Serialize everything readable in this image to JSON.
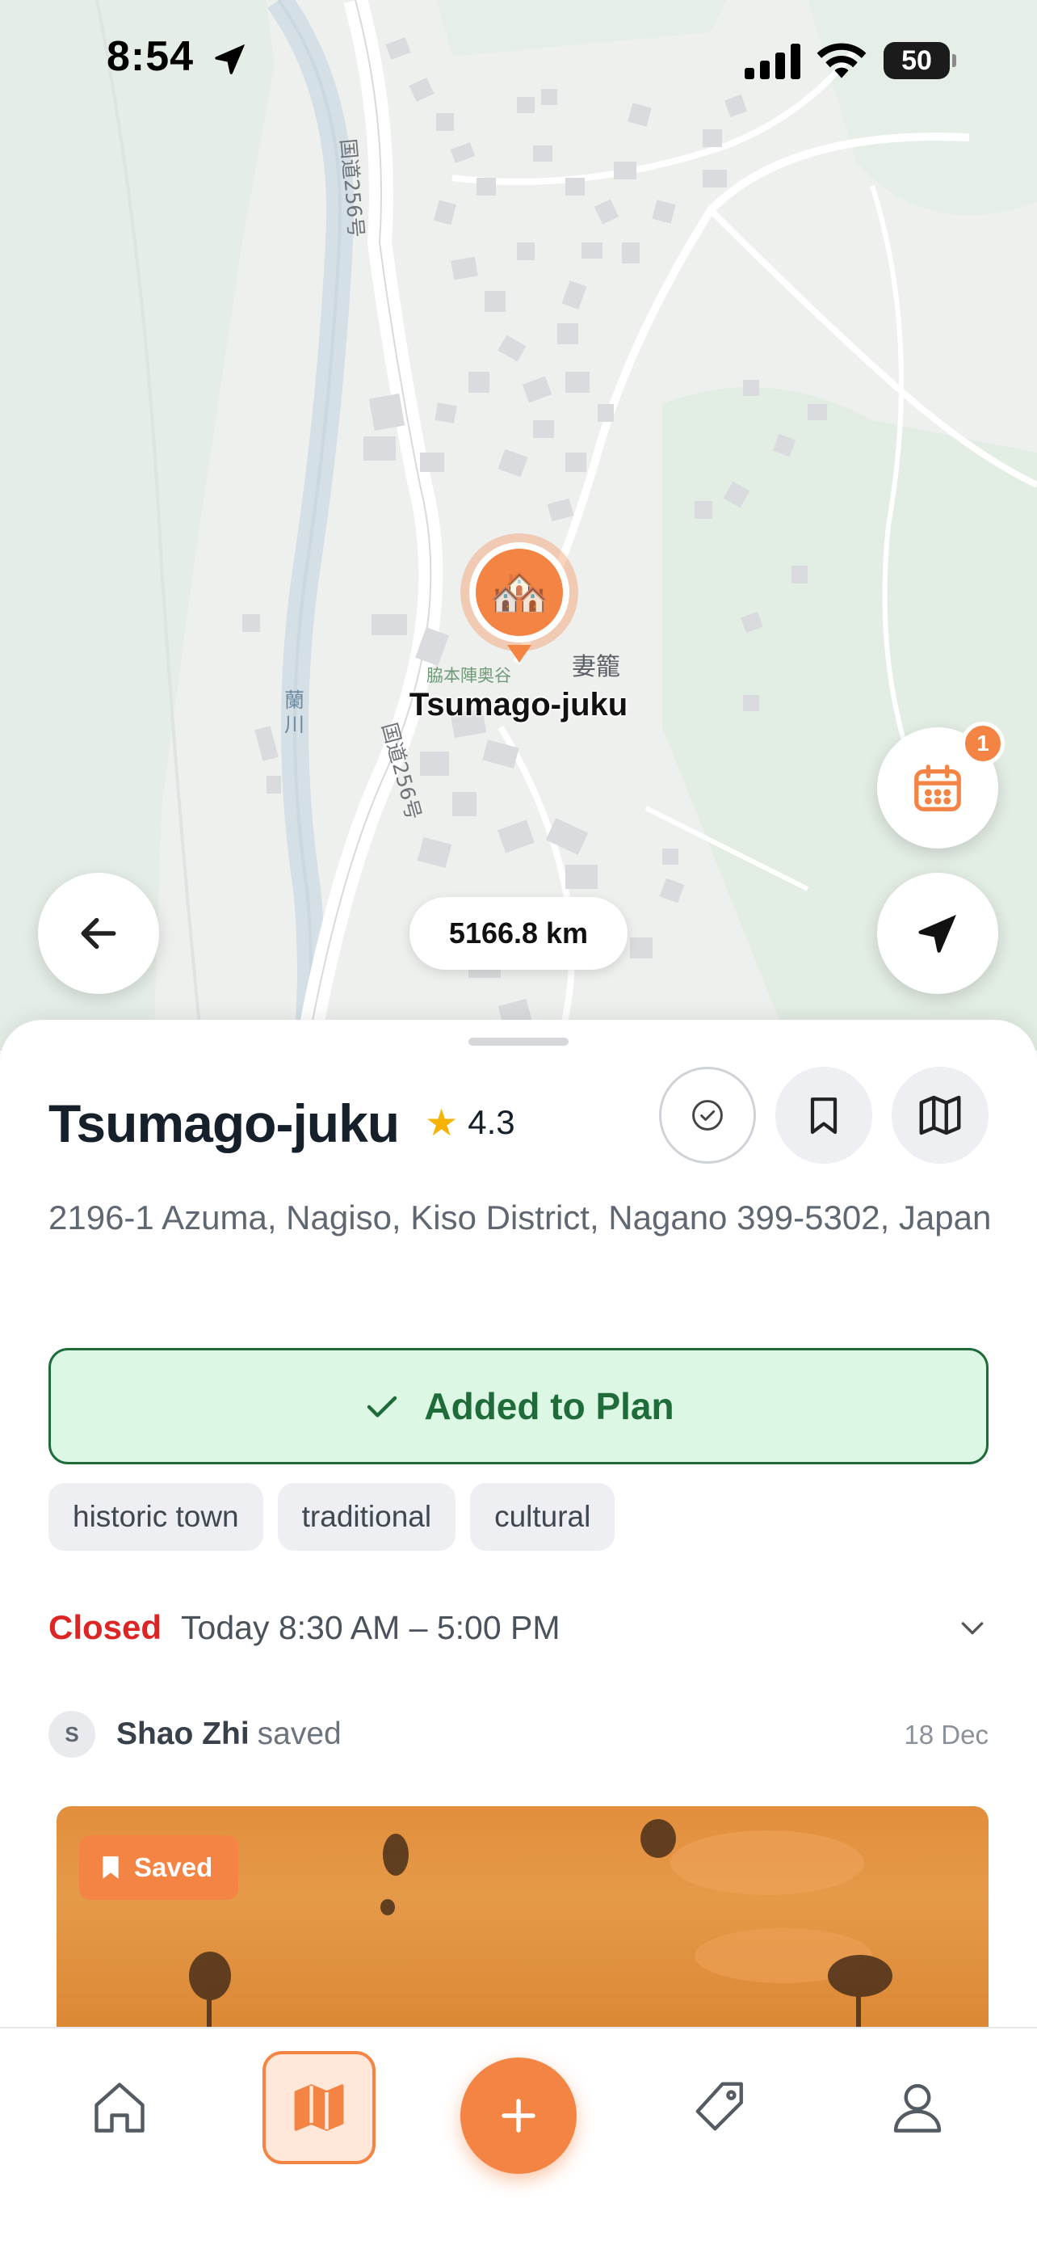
{
  "status_bar": {
    "time": "8:54",
    "battery": "50"
  },
  "map": {
    "road_label_1": "国道256号",
    "road_label_2": "国道256号",
    "river_label": "蘭川",
    "place_label": "妻籠",
    "poi_label": "脇本陣奥谷",
    "pin_label": "Tsumago-juku",
    "pin_emoji": "🏘️",
    "distance": "5166.8 km",
    "calendar_badge_count": "1"
  },
  "place": {
    "name": "Tsumago-juku",
    "rating": "4.3",
    "address": "2196-1 Azuma, Nagiso, Kiso District, Nagano 399-5302, Japan",
    "plan_button_label": "Added to Plan",
    "tags": [
      "historic town",
      "traditional",
      "cultural"
    ],
    "hours_status": "Closed",
    "hours_text": "Today 8:30 AM – 5:00 PM",
    "saved_by": {
      "initial": "S",
      "name": "Shao Zhi",
      "action": "saved",
      "date": "18 Dec"
    },
    "photo_badge": "Saved"
  },
  "colors": {
    "accent": "#f48444",
    "success_bg": "#dcf8e4",
    "success_text": "#1f6b3a",
    "closed_red": "#dc2626",
    "star": "#f6b200"
  },
  "icons": {
    "back": "arrow-left-icon",
    "calendar": "calendar-icon",
    "locate": "navigation-arrow-icon",
    "visited": "check-circle-icon",
    "bookmark": "bookmark-icon",
    "map": "map-icon",
    "tabs": [
      "home-icon",
      "map-icon",
      "plus-icon",
      "tag-icon",
      "user-icon"
    ]
  }
}
